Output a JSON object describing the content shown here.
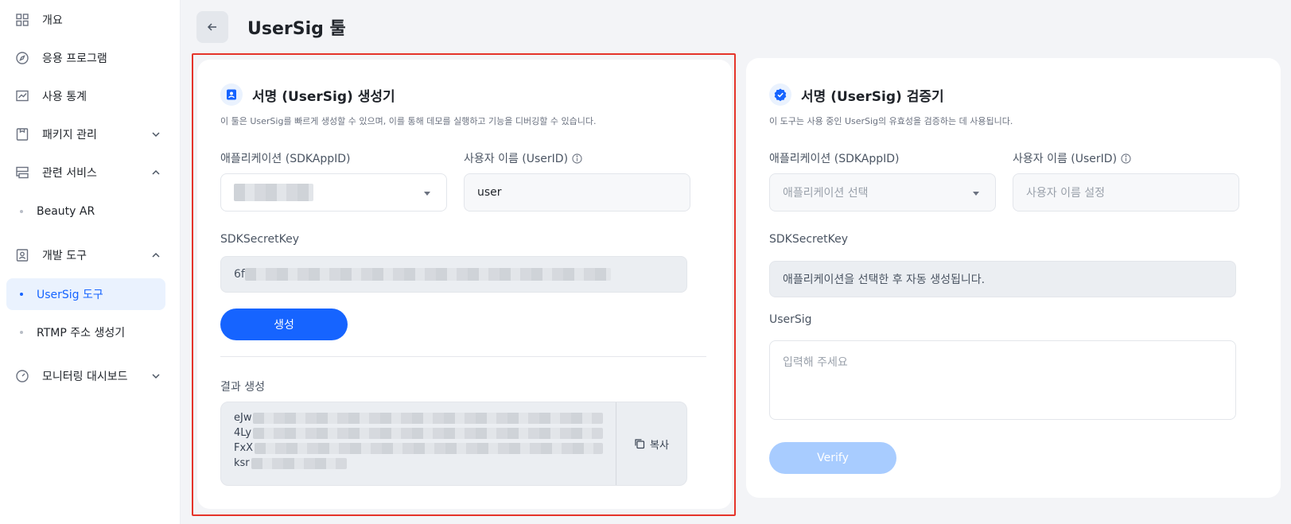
{
  "sidebar": {
    "items": [
      {
        "label": "개요",
        "icon": "grid-icon"
      },
      {
        "label": "응용 프로그램",
        "icon": "compass-icon"
      },
      {
        "label": "사용 통계",
        "icon": "chart-icon"
      },
      {
        "label": "패키지 관리",
        "icon": "package-icon"
      },
      {
        "label": "관련 서비스",
        "icon": "services-icon"
      },
      {
        "label": "개발 도구",
        "icon": "dev-tools-icon"
      },
      {
        "label": "모니터링 대시보드",
        "icon": "gauge-icon"
      }
    ],
    "sub_items": {
      "beauty_ar": "Beauty AR",
      "usersig_tool": "UserSig 도구",
      "rtmp": "RTMP 주소 생성기"
    }
  },
  "header": {
    "title": "UserSig 툴"
  },
  "generator": {
    "title": "서명 (UserSig) 생성기",
    "description": "이 툴은 UserSig를 빠르게 생성할 수 있으며, 이를 통해 데모를 실행하고 기능을 디버깅할 수 있습니다.",
    "app_label": "애플리케이션 (SDKAppID)",
    "user_label": "사용자 이름 (UserID)",
    "user_value": "user",
    "secret_label": "SDKSecretKey",
    "secret_prefix": "6f",
    "generate_button": "생성",
    "result_label": "결과 생성",
    "result_prefixes": [
      "eJw",
      "4Ly",
      "FxX",
      "ksr"
    ],
    "copy_label": "복사"
  },
  "verifier": {
    "title": "서명 (UserSig) 검증기",
    "description": "이 도구는 사용 중인 UserSig의 유효성을 검증하는 데 사용됩니다.",
    "app_label": "애플리케이션 (SDKAppID)",
    "app_placeholder": "애플리케이션 선택",
    "user_label": "사용자 이름 (UserID)",
    "user_placeholder": "사용자 이름 설정",
    "secret_label": "SDKSecretKey",
    "secret_hint": "애플리케이션을 선택한 후 자동 생성됩니다.",
    "usersig_label": "UserSig",
    "usersig_placeholder": "입력해 주세요",
    "verify_button": "Verify"
  },
  "colors": {
    "primary": "#1664ff",
    "primary_disabled": "#a8ccff",
    "highlight": "#e5342a",
    "active_bg": "#eaf2fe"
  }
}
